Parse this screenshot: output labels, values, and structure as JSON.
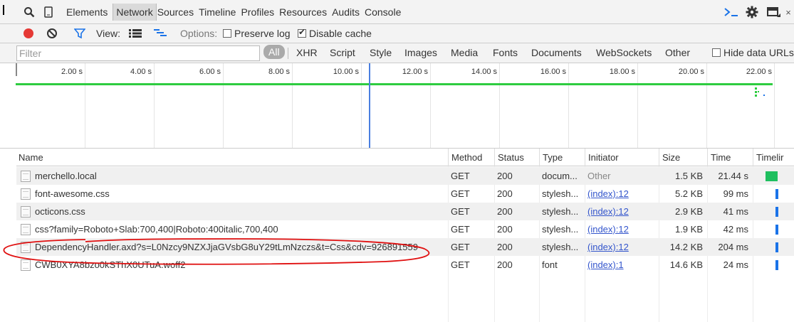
{
  "tabs": [
    "Elements",
    "Network",
    "Sources",
    "Timeline",
    "Profiles",
    "Resources",
    "Audits",
    "Console"
  ],
  "active_tab": "Network",
  "toolbar": {
    "view_label": "View:",
    "options_label": "Options:",
    "preserve_log": "Preserve log",
    "preserve_log_checked": false,
    "disable_cache": "Disable cache",
    "disable_cache_checked": true
  },
  "filter": {
    "placeholder": "Filter",
    "types": [
      "All",
      "XHR",
      "Script",
      "Style",
      "Images",
      "Media",
      "Fonts",
      "Documents",
      "WebSockets",
      "Other"
    ],
    "hide_data_urls": "Hide data URLs"
  },
  "overview": {
    "ticks": [
      "2.00 s",
      "4.00 s",
      "6.00 s",
      "8.00 s",
      "10.00 s",
      "12.00 s",
      "14.00 s",
      "16.00 s",
      "18.00 s",
      "20.00 s",
      "22.00 s"
    ],
    "colors": {
      "timeline_line": "#2ecc40",
      "load_marker": "#4a7fe0"
    }
  },
  "table": {
    "columns": [
      "Name",
      "Method",
      "Status",
      "Type",
      "Initiator",
      "Size",
      "Time",
      "Timelir"
    ],
    "rows": [
      {
        "name": "merchello.local",
        "method": "GET",
        "status": "200",
        "type": "docum...",
        "initiator": "Other",
        "size": "1.5 KB",
        "time": "21.44 s",
        "bar_color": "#1fbf5f"
      },
      {
        "name": "font-awesome.css",
        "method": "GET",
        "status": "200",
        "type": "stylesh...",
        "initiator": "(index):12",
        "size": "5.2 KB",
        "time": "99 ms",
        "bar_color": "#1a73e8"
      },
      {
        "name": "octicons.css",
        "method": "GET",
        "status": "200",
        "type": "stylesh...",
        "initiator": "(index):12",
        "size": "2.9 KB",
        "time": "41 ms",
        "bar_color": "#1a73e8"
      },
      {
        "name": "css?family=Roboto+Slab:700,400|Roboto:400italic,700,400",
        "method": "GET",
        "status": "200",
        "type": "stylesh...",
        "initiator": "(index):12",
        "size": "1.9 KB",
        "time": "42 ms",
        "bar_color": "#1a73e8"
      },
      {
        "name": "DependencyHandler.axd?s=L0Nzcy9NZXJjaGVsbG8uY29tLmNzczs&t=Css&cdv=926891559",
        "method": "GET",
        "status": "200",
        "type": "stylesh...",
        "initiator": "(index):12",
        "size": "14.2 KB",
        "time": "204 ms",
        "bar_color": "#1a73e8"
      },
      {
        "name": "CWB0XYA8bzo0kSThX0UTuA.woff2",
        "method": "GET",
        "status": "200",
        "type": "font",
        "initiator": "(index):1",
        "size": "14.6 KB",
        "time": "24 ms",
        "bar_color": "#1a73e8"
      }
    ]
  },
  "annotation_color": "#e01010"
}
